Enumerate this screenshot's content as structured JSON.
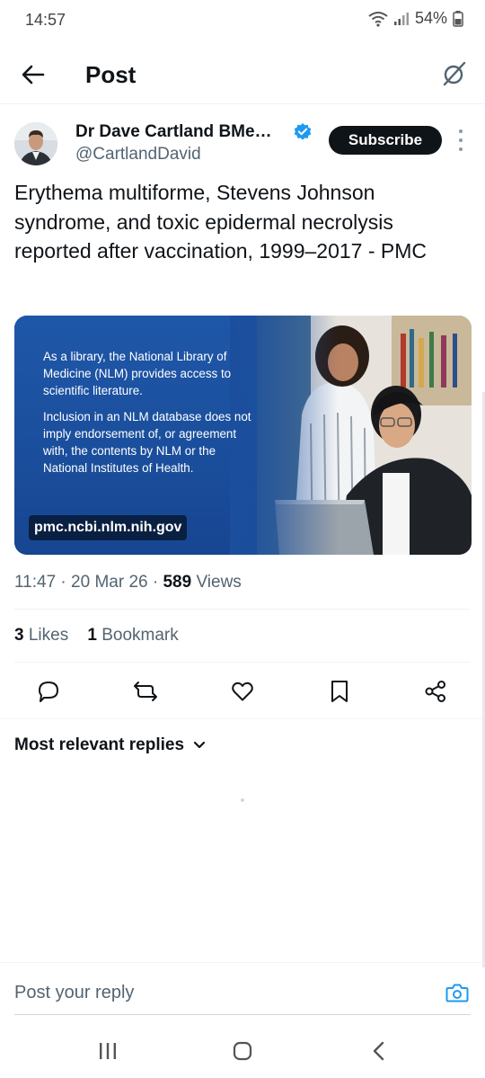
{
  "status_bar": {
    "time": "14:57",
    "battery": "54%"
  },
  "header": {
    "title": "Post"
  },
  "author": {
    "name": "Dr Dave Cartland BMe…",
    "handle": "@CartlandDavid",
    "subscribe_label": "Subscribe"
  },
  "post": {
    "text": "Erythema multiforme, Stevens Johnson syndrome, and toxic epidermal necrolysis reported after vaccination, 1999–2017 - PMC"
  },
  "link_card": {
    "paragraph1": "As a library, the National Library of Medicine (NLM) provides access to scientific literature.",
    "paragraph2": "Inclusion in an NLM database does not imply endorsement of, or agreement with, the contents by NLM or the National Institutes of Health.",
    "domain": "pmc.ncbi.nlm.nih.gov"
  },
  "meta": {
    "time": "11:47",
    "date": "20 Mar 26",
    "views_count": "589",
    "views_label": "Views"
  },
  "stats": {
    "likes_count": "3",
    "likes_label": "Likes",
    "bookmarks_count": "1",
    "bookmarks_label": "Bookmark"
  },
  "actions": [
    "reply-icon",
    "repost-icon",
    "like-icon",
    "bookmark-icon",
    "share-icon"
  ],
  "replies": {
    "sort_label": "Most relevant replies"
  },
  "reply_bar": {
    "placeholder": "Post your reply"
  },
  "colors": {
    "accent": "#1d9bf0",
    "text": "#0f1419",
    "secondary": "#536471",
    "card_blue": "#1a4e9c"
  }
}
